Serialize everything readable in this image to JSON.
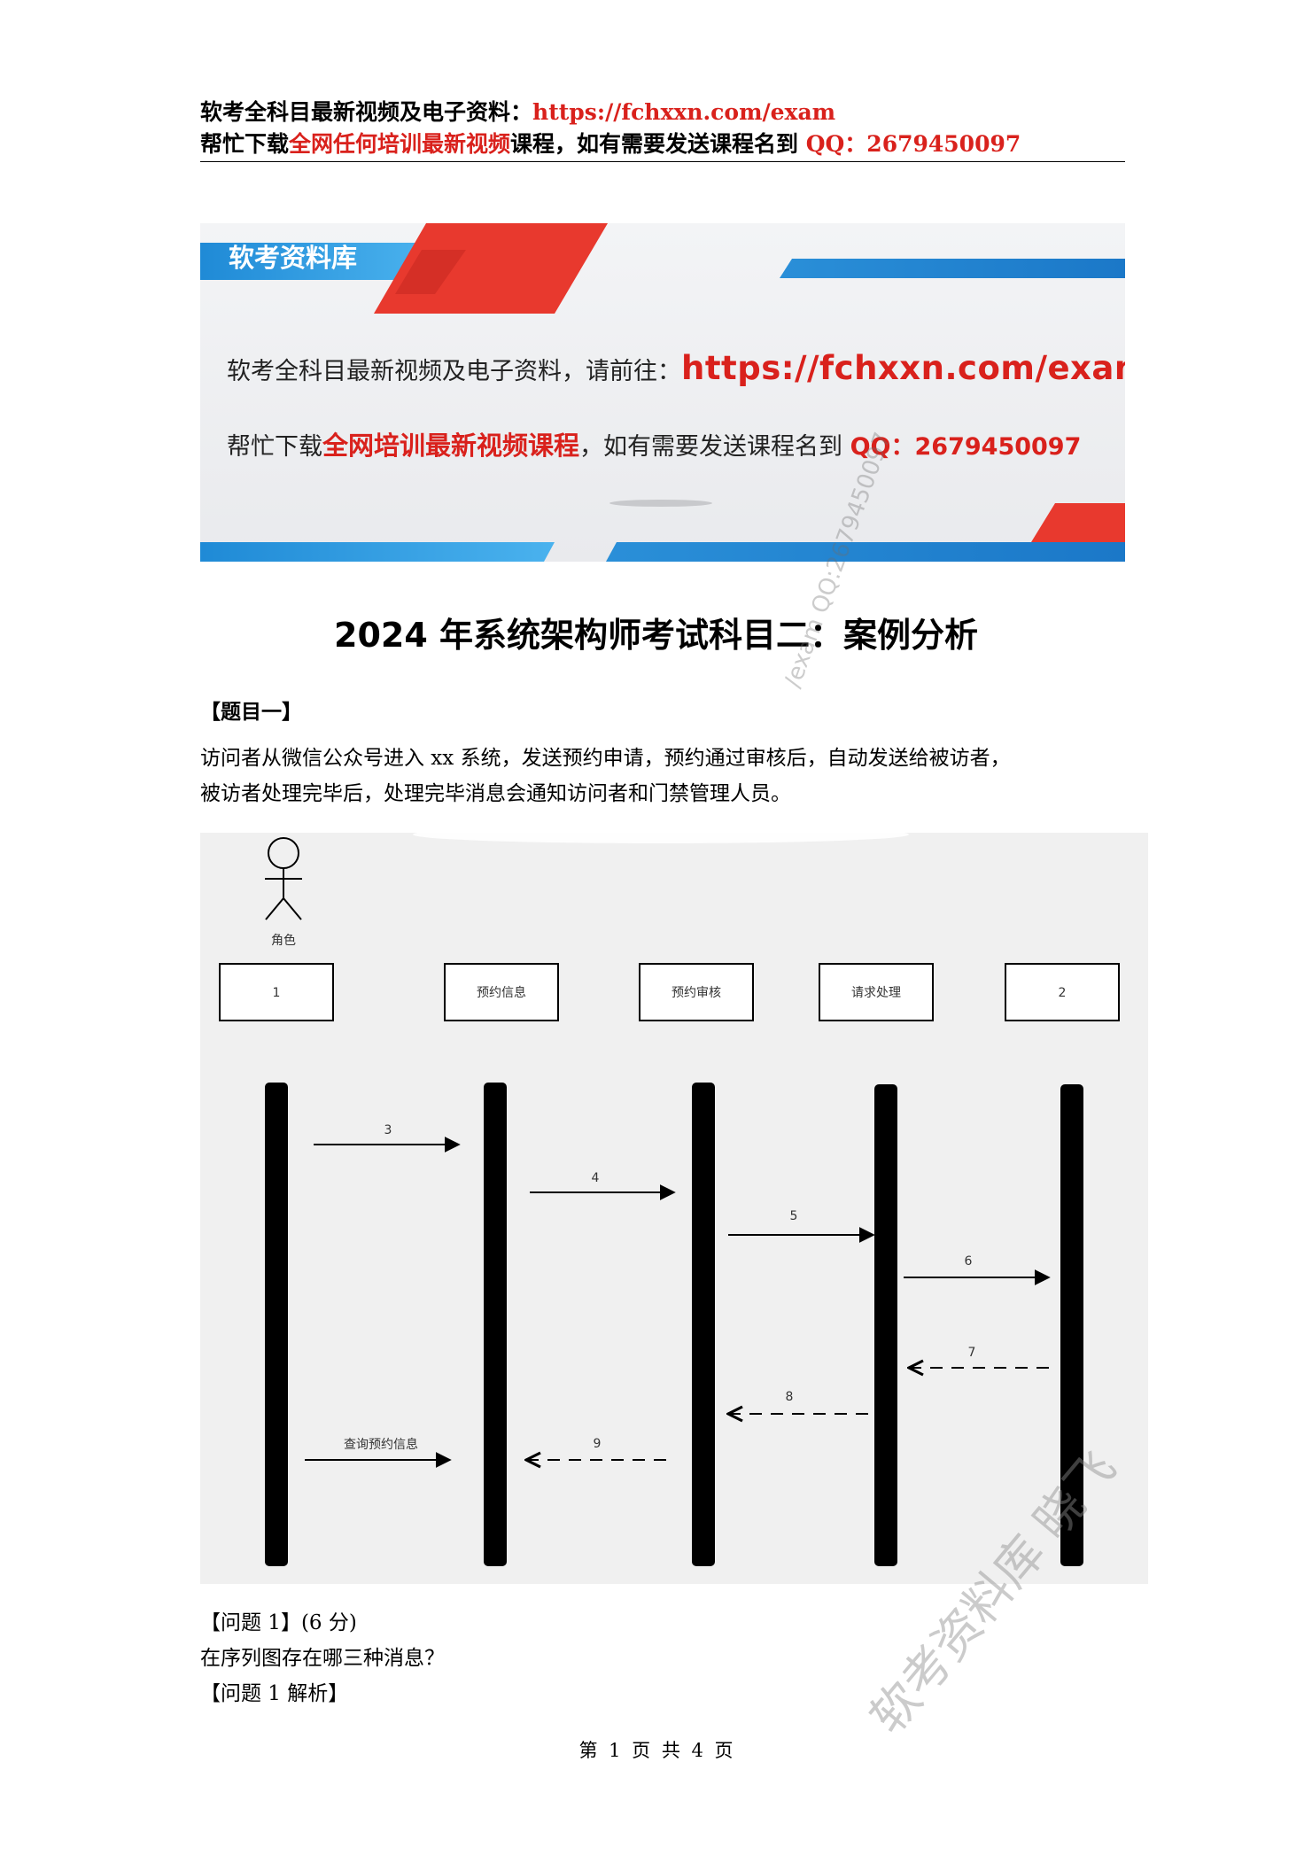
{
  "header": {
    "line1_prefix": "软考全科目最新视频及电子资料：",
    "line1_url": "https://fchxxn.com/exam",
    "line2_prefix": "帮忙下载",
    "line2_highlight": "全网任何培训最新视频",
    "line2_middle": "课程，如有需要发送课程名到 ",
    "line2_qq": "QQ：2679450097"
  },
  "banner": {
    "title": "软考资料库",
    "line1_prefix": "软考全科目最新视频及电子资料，请前往：",
    "line1_url": "https://fchxxn.com/exam",
    "line2_prefix": "帮忙下载",
    "line2_highlight": "全网培训最新视频课程",
    "line2_middle": "，如有需要发送课程名到 ",
    "line2_qq": "QQ：2679450097"
  },
  "document": {
    "title": "2024 年系统架构师考试科目二：案例分析",
    "question_heading": "【题目一】",
    "description_line1": "访问者从微信公众号进入 xx 系统，发送预约申请，预约通过审核后，自动发送给被访者，",
    "description_line2": "被访者处理完毕后，处理完毕消息会通知访问者和门禁管理人员。",
    "problem1_heading": "【问题 1】(6 分)",
    "problem1_text": "在序列图存在哪三种消息？",
    "problem1_analysis": "【问题 1 解析】"
  },
  "diagram": {
    "actor_label": "角色",
    "participants": [
      "1",
      "预约信息",
      "预约审核",
      "请求处理",
      "2"
    ],
    "messages": [
      {
        "label": "3",
        "from": 0,
        "to": 1,
        "style": "solid"
      },
      {
        "label": "4",
        "from": 1,
        "to": 2,
        "style": "solid"
      },
      {
        "label": "5",
        "from": 2,
        "to": 3,
        "style": "solid"
      },
      {
        "label": "6",
        "from": 3,
        "to": 4,
        "style": "solid"
      },
      {
        "label": "7",
        "from": 4,
        "to": 3,
        "style": "dashed"
      },
      {
        "label": "8",
        "from": 3,
        "to": 2,
        "style": "dashed"
      },
      {
        "label": "查询预约信息",
        "from": 0,
        "to": 1,
        "style": "solid"
      },
      {
        "label": "9",
        "from": 2,
        "to": 1,
        "style": "dashed"
      }
    ]
  },
  "watermarks": {
    "diagonal_small": "/exam QQ:2679450097",
    "diagonal_large": "软考资料库 晓飞"
  },
  "footer": {
    "page_text": "第 1 页 共 4 页"
  }
}
